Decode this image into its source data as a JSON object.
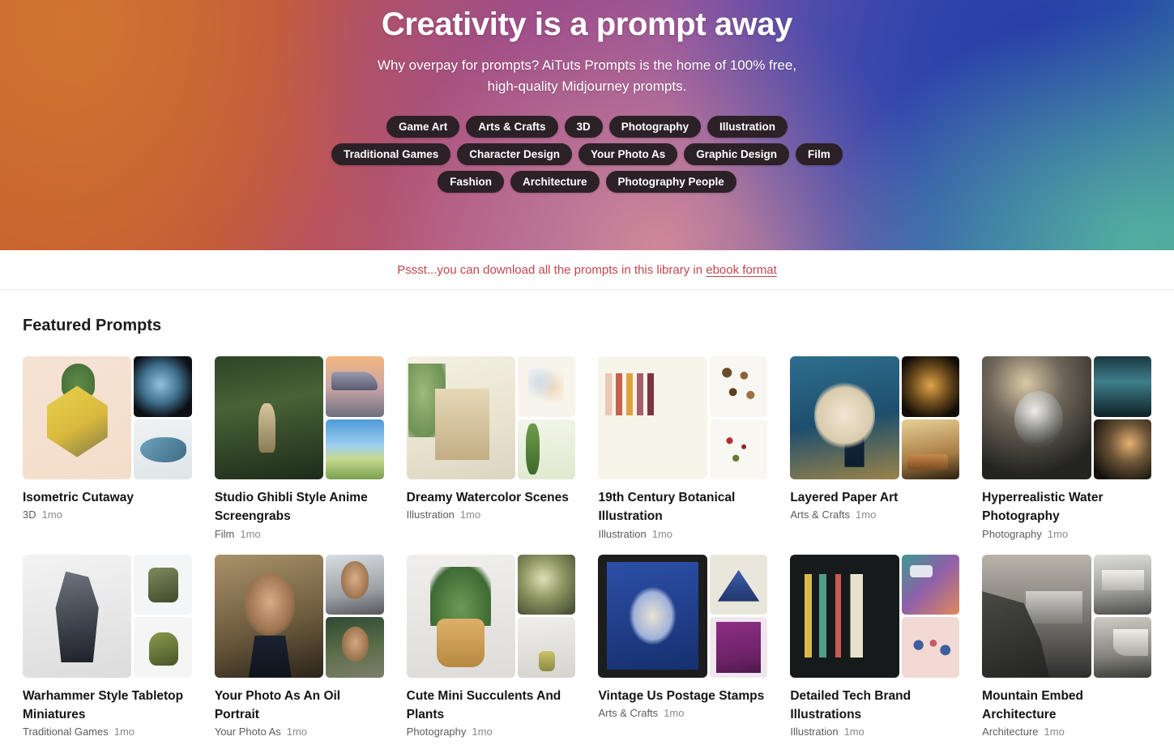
{
  "hero": {
    "title": "Creativity is a prompt away",
    "subtitle": "Why overpay for prompts? AiTuts Prompts is the home of 100% free, high-quality Midjourney prompts.",
    "tags": [
      "Game Art",
      "Arts & Crafts",
      "3D",
      "Photography",
      "Illustration",
      "Traditional Games",
      "Character Design",
      "Your Photo As",
      "Graphic Design",
      "Film",
      "Fashion",
      "Architecture",
      "Photography People"
    ]
  },
  "ebook_banner": {
    "text_before": "Pssst...you can download all the prompts in this library in ",
    "link_label": "ebook format",
    "color": "#c4444f"
  },
  "featured": {
    "heading": "Featured Prompts",
    "cards": [
      {
        "title": "Isometric Cutaway",
        "category": "3D",
        "age": "1mo",
        "main_art": "a-iso",
        "thumb1_art": "a-globe",
        "thumb2_art": "a-whale"
      },
      {
        "title": "Studio Ghibli Style Anime Screengrabs",
        "category": "Film",
        "age": "1mo",
        "main_art": "a-ghibli",
        "thumb1_art": "a-ship",
        "thumb2_art": "a-field"
      },
      {
        "title": "Dreamy Watercolor Scenes",
        "category": "Illustration",
        "age": "1mo",
        "main_art": "a-house",
        "thumb1_art": "a-bouq",
        "thumb2_art": "a-fern"
      },
      {
        "title": "19th Century Botanical Illustration",
        "category": "Illustration",
        "age": "1mo",
        "main_art": "a-tulip",
        "thumb1_art": "a-cone",
        "thumb2_art": "a-cherry"
      },
      {
        "title": "Layered Paper Art",
        "category": "Arts & Crafts",
        "age": "1mo",
        "main_art": "a-paper",
        "thumb1_art": "a-lamp",
        "thumb2_art": "a-train"
      },
      {
        "title": "Hyperrealistic Water Photography",
        "category": "Photography",
        "age": "1mo",
        "main_art": "a-water",
        "thumb1_art": "a-wave",
        "thumb2_art": "a-splash"
      },
      {
        "title": "Warhammer Style Tabletop Miniatures",
        "category": "Traditional Games",
        "age": "1mo",
        "main_art": "a-wh",
        "thumb1_art": "a-mech",
        "thumb2_art": "a-orc"
      },
      {
        "title": "Your Photo As An Oil Portrait",
        "category": "Your Photo As",
        "age": "1mo",
        "main_art": "a-port",
        "thumb1_art": "a-face1",
        "thumb2_art": "a-face2"
      },
      {
        "title": "Cute Mini Succulents And Plants",
        "category": "Photography",
        "age": "1mo",
        "main_art": "a-succ",
        "thumb1_art": "a-pot1",
        "thumb2_art": "a-pot2"
      },
      {
        "title": "Vintage Us Postage Stamps",
        "category": "Arts & Crafts",
        "age": "1mo",
        "main_art": "a-stamp",
        "thumb1_art": "a-pyr",
        "thumb2_art": "a-wash"
      },
      {
        "title": "Detailed Tech Brand Illustrations",
        "category": "Illustration",
        "age": "1mo",
        "main_art": "a-tech",
        "thumb1_art": "a-chat",
        "thumb2_art": "a-team"
      },
      {
        "title": "Mountain Embed Architecture",
        "category": "Architecture",
        "age": "1mo",
        "main_art": "a-cliff",
        "thumb1_art": "a-arch1",
        "thumb2_art": "a-arch2"
      }
    ]
  }
}
